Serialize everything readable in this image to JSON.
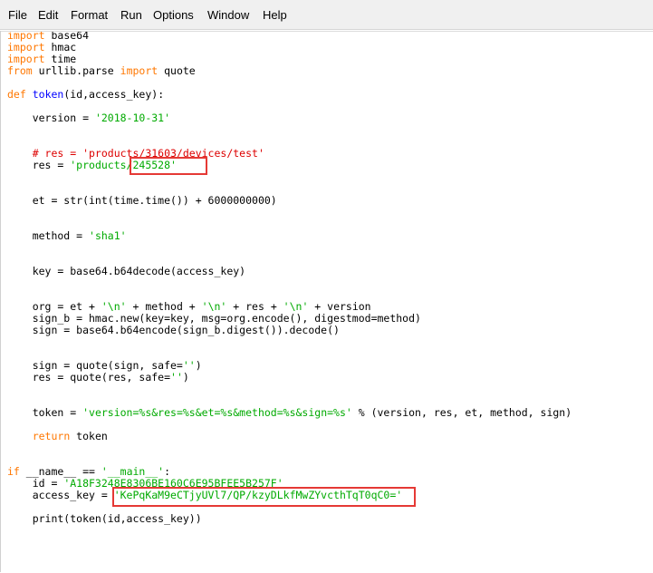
{
  "menu": {
    "items": [
      "File",
      "Edit",
      "Format",
      "Run",
      "Options",
      "Window",
      "Help"
    ]
  },
  "code": {
    "l01_kw": "import",
    "l01_rest": " base64",
    "l02_kw": "import",
    "l02_rest": " hmac",
    "l03_kw": "import",
    "l03_rest": " time",
    "l04_kw1": "from",
    "l04_mid": " urllib.parse ",
    "l04_kw2": "import",
    "l04_rest": " quote",
    "l05_kw": "def",
    "l05_fn": "token",
    "l05_rest": "(id,access_key):",
    "l06_a": "    version = ",
    "l06_s": "'2018-10-31'",
    "l07_cmt": "    # res = 'products/31603/devices/test'",
    "l08_a": "    res = ",
    "l08_s": "'products/245528'",
    "l09": "    et = str(int(time.time()) + 6000000000)",
    "l10_a": "    method = ",
    "l10_s": "'sha1'",
    "l11": "    key = base64.b64decode(access_key)",
    "l12_a": "    org = et + ",
    "l12_s1": "'\\n'",
    "l12_b": " + method + ",
    "l12_s2": "'\\n'",
    "l12_c": " + res + ",
    "l12_s3": "'\\n'",
    "l12_d": " + version",
    "l13": "    sign_b = hmac.new(key=key, msg=org.encode(), digestmod=method)",
    "l14": "    sign = base64.b64encode(sign_b.digest()).decode()",
    "l15_a": "    sign = quote(sign, safe=",
    "l15_s": "''",
    "l15_b": ")",
    "l16_a": "    res = quote(res, safe=",
    "l16_s": "''",
    "l16_b": ")",
    "l17_a": "    token = ",
    "l17_s": "'version=%s&res=%s&et=%s&method=%s&sign=%s'",
    "l17_b": " % (version, res, et, method, sign)",
    "l18_pre": "    ",
    "l18_kw": "return",
    "l18_rest": " token",
    "l19_kw": "if",
    "l19_a": " __name__ == ",
    "l19_s": "'__main__'",
    "l19_b": ":",
    "l20_a": "    id = ",
    "l20_s": "'A18F3248E8306BE160C6E95BFEE5B257F'",
    "l21_a": "    access_key = ",
    "l21_s": "'KePqKaM9eCTjyUVl7/QP/kzyDLkfMwZYvcthTqT0qC0='",
    "l22": "    print(token(id,access_key))"
  },
  "colors": {
    "keyword": "#ff7700",
    "string": "#00aa00",
    "comment": "#dd0000",
    "defname": "#0000ff",
    "highlight_box": "#e53935"
  }
}
